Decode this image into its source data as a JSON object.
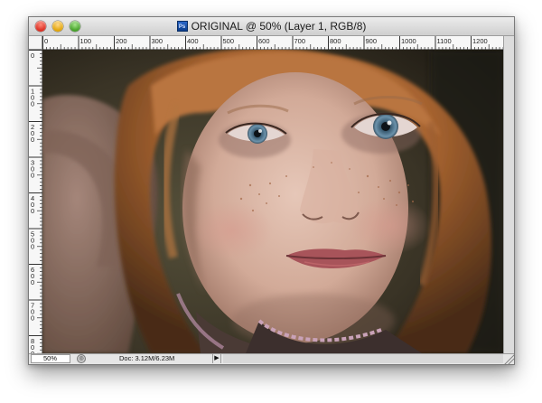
{
  "window": {
    "app_icon": "photoshop-document-icon",
    "app_icon_text": "Ps",
    "title": "ORIGINAL @ 50% (Layer 1, RGB/8)"
  },
  "rulers": {
    "horizontal_labels": [
      "0",
      "100",
      "200",
      "300",
      "400",
      "500",
      "600",
      "700",
      "800",
      "900",
      "1000",
      "1100",
      "1200"
    ],
    "vertical_labels": [
      "0",
      "100",
      "200",
      "300",
      "400",
      "500",
      "600",
      "700",
      "800"
    ]
  },
  "canvas": {
    "description_icon": "photo-canvas",
    "colors": {
      "background_dark": "#2a2419",
      "hair": "#b56d3a",
      "skin": "#d9b3a4",
      "eye": "#4d7590"
    }
  },
  "status": {
    "zoom": "50%",
    "doc_info": "Doc: 3.12M/6.23M",
    "menu_arrow": "▶"
  }
}
